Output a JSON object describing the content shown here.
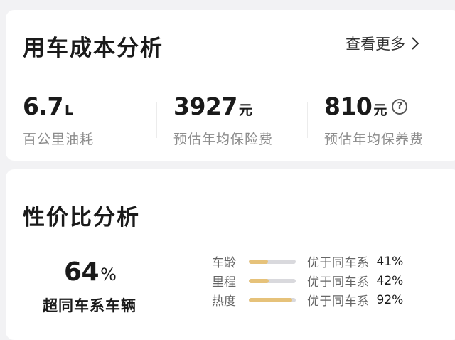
{
  "cost": {
    "title": "用车成本分析",
    "more_label": "查看更多",
    "metrics": [
      {
        "value": "6.7",
        "unit": "L",
        "label": "百公里油耗"
      },
      {
        "value": "3927",
        "unit": "元",
        "label": "预估年均保险费"
      },
      {
        "value": "810",
        "unit": "元",
        "label": "预估年均保养费",
        "help_icon": "question-circle"
      }
    ]
  },
  "value": {
    "title": "性价比分析",
    "percent": "64",
    "percent_unit": "%",
    "percent_label": "超同车系车辆",
    "rows": [
      {
        "label": "车龄",
        "text": "优于同车系",
        "pct_text": "41%",
        "fraction": 0.41
      },
      {
        "label": "里程",
        "text": "优于同车系",
        "pct_text": "42%",
        "fraction": 0.42
      },
      {
        "label": "热度",
        "text": "优于同车系",
        "pct_text": "92%",
        "fraction": 0.92
      }
    ]
  },
  "colors": {
    "bar_fill": "#e6c27a",
    "bar_track": "#d9d9dd",
    "label_gray": "#8b8b8b"
  }
}
